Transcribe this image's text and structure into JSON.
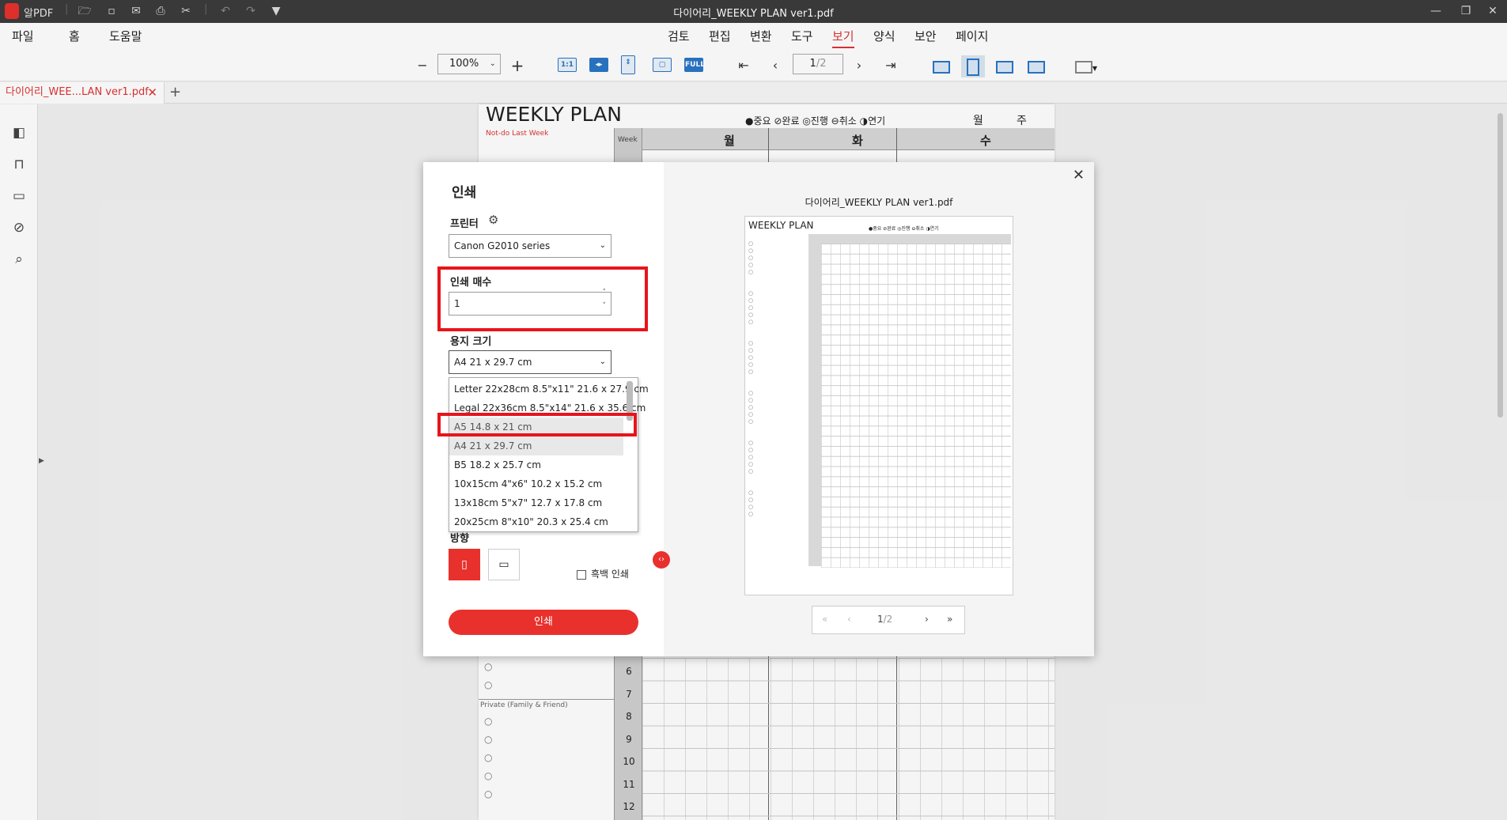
{
  "app": {
    "name": "알PDF",
    "window_title": "다이어리_WEEKLY PLAN ver1.pdf"
  },
  "menu": {
    "left": [
      "파일",
      "홈",
      "도움말"
    ],
    "tabs": [
      "검토",
      "편집",
      "변환",
      "도구",
      "보기",
      "양식",
      "보안",
      "페이지"
    ],
    "active_tab": "보기"
  },
  "toolbar": {
    "zoom": "100%",
    "actual_size_label": "1:1",
    "full_label": "FULL",
    "page_current": "1",
    "page_total": "/2"
  },
  "doc_tab": {
    "label": "다이어리_WEE...LAN ver1.pdf"
  },
  "document": {
    "title": "WEEKLY PLAN",
    "legend": "●중요 ⊘완료 ◎진행 ⊖취소 ◑연기",
    "month_label": "월",
    "week_label": "주",
    "not_do": "Not-do Last Week",
    "week_col": "Week",
    "days": [
      "월",
      "화",
      "수"
    ],
    "private_label": "Private (Family & Friend)",
    "row_numbers": [
      "6",
      "7",
      "8",
      "9",
      "10",
      "11",
      "12"
    ]
  },
  "dialog": {
    "title": "인쇄",
    "printer_label": "프린터",
    "printer_value": "Canon G2010 series",
    "copies_label": "인쇄 매수",
    "copies_value": "1",
    "paper_label": "용지 크기",
    "paper_value": "A4 21 x 29.7 cm",
    "paper_options": [
      "Letter 22x28cm 8.5\"x11\" 21.6 x 27.9 cm",
      "Legal 22x36cm 8.5\"x14\" 21.6 x 35.6 cm",
      "A5 14.8 x 21 cm",
      "A4 21 x 29.7 cm",
      "B5 18.2 x 25.7 cm",
      "10x15cm 4\"x6\" 10.2 x 15.2 cm",
      "13x18cm 5\"x7\" 12.7 x 17.8 cm",
      "20x25cm 8\"x10\" 20.3 x 25.4 cm"
    ],
    "orientation_label": "방향",
    "bw_label": "흑백 인쇄",
    "print_button": "인쇄",
    "preview_filename": "다이어리_WEEKLY PLAN ver1.pdf",
    "preview_page": "1",
    "preview_total": "/2"
  },
  "colors": {
    "accent_red": "#e8312d",
    "highlight_red": "#e8141b",
    "titlebar": "#3c3c3c",
    "toolbar_blue": "#2a76c6"
  }
}
